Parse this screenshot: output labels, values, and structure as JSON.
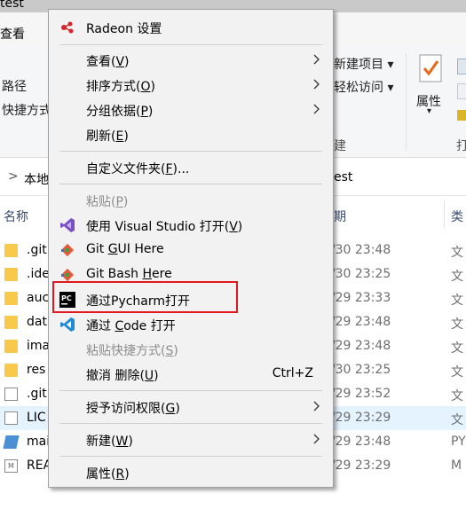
{
  "window": {
    "title_partial": "test",
    "tab_partial": "查看"
  },
  "ribbon": {
    "left": [
      "路径",
      "快捷方式"
    ],
    "new_item": "新建项目 ▾",
    "easy_access": "轻松访问 ▾",
    "properties": "属性",
    "group_new": "建",
    "group_open": "打"
  },
  "address": {
    "chevron": ">",
    "prefix": "本地",
    "suffix": "est"
  },
  "columns": {
    "name": "名称",
    "date": "期",
    "type": "类"
  },
  "files": [
    {
      "name": ".git",
      "date": "3/30 23:48",
      "type": "文",
      "kind": "folder"
    },
    {
      "name": ".ide",
      "date": "3/30 23:25",
      "type": "文",
      "kind": "folder"
    },
    {
      "name": "auc",
      "date": "3/29 23:33",
      "type": "文",
      "kind": "folder"
    },
    {
      "name": "dat",
      "date": "3/29 23:48",
      "type": "文",
      "kind": "folder"
    },
    {
      "name": "ima",
      "date": "3/29 23:48",
      "type": "文",
      "kind": "folder"
    },
    {
      "name": "res",
      "date": "3/30 23:25",
      "type": "文",
      "kind": "folder"
    },
    {
      "name": ".git",
      "date": "3/29 23:52",
      "type": "文",
      "kind": "file"
    },
    {
      "name": "LIC",
      "date": "3/29 23:29",
      "type": "文",
      "kind": "file"
    },
    {
      "name": "mai",
      "date": "3/29 23:48",
      "type": "PY",
      "kind": "python"
    },
    {
      "name": "REA",
      "date": "3/29 23:29",
      "type": "M",
      "kind": "markdown"
    }
  ],
  "menu": {
    "radeon": "Radeon 设置",
    "view": {
      "text": "查看(",
      "key": "V",
      "tail": ")"
    },
    "sort": {
      "text": "排序方式(",
      "key": "O",
      "tail": ")"
    },
    "group": {
      "text": "分组依据(",
      "key": "P",
      "tail": ")"
    },
    "refresh": {
      "text": "刷新(",
      "key": "E",
      "tail": ")"
    },
    "customize": {
      "text": "自定义文件夹(",
      "key": "F",
      "tail": ")..."
    },
    "paste": {
      "text": "粘贴(",
      "key": "P",
      "tail": ")"
    },
    "vs": {
      "text": "使用 Visual Studio 打开(",
      "key": "V",
      "tail": ")"
    },
    "gitgui": {
      "pre": "Git ",
      "key": "G",
      "text": "UI Here"
    },
    "gitbash": {
      "pre": "Git Bash ",
      "key": "H",
      "text": "ere"
    },
    "pycharm": "通过Pycharm打开",
    "vscode": {
      "pre": "通过 ",
      "key": "C",
      "text": "ode 打开"
    },
    "paste_shortcut": {
      "text": "粘贴快捷方式(",
      "key": "S",
      "tail": ")"
    },
    "undo": {
      "text": "撤消 删除(",
      "key": "U",
      "tail": ")"
    },
    "undo_shortcut": "Ctrl+Z",
    "grant": {
      "text": "授予访问权限(",
      "key": "G",
      "tail": ")"
    },
    "new": {
      "text": "新建(",
      "key": "W",
      "tail": ")"
    },
    "props": {
      "text": "属性(",
      "key": "R",
      "tail": ")"
    }
  },
  "colors": {
    "highlight_box": "#e0191f",
    "menu_bg": "#f2f2f2",
    "folder": "#f8c94a"
  }
}
